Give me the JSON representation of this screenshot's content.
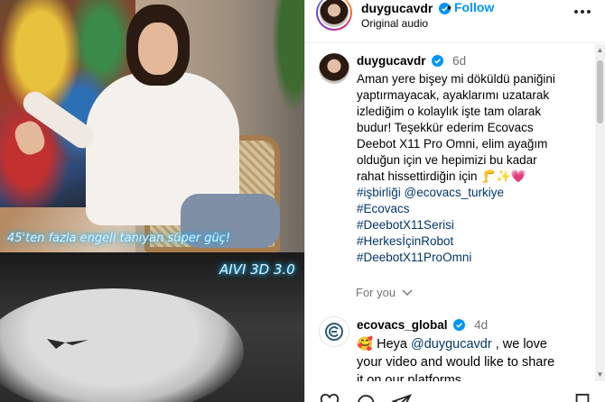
{
  "media": {
    "caption_top": "45'ten fazla engeli tanıyan süper güç!",
    "caption_bottom": "AIVI 3D 3.0"
  },
  "header": {
    "username": "duygucavdr",
    "separator": "•",
    "follow_label": "Follow",
    "audio": "Original audio"
  },
  "caption_comment": {
    "username": "duygucavdr",
    "time": "6d",
    "text": "Aman yere bişey mi döküldü paniğini yaptırmayacak, ayaklarımı uzatarak izlediğim o kolaylık işte tam olarak budur! Teşekkür ederim Ecovacs Deebot X11 Pro Omni, elim ayağım olduğun için ve hepimizi bu kadar rahat hissettirdiğin için 🦵✨💗",
    "hashtag_1": "#işbirliği",
    "mention_1": "@ecovacs_turkiye",
    "hashtag_2": "#Ecovacs",
    "hashtag_3": "#DeebotX11Serisi",
    "hashtag_4": "#HerkesİçinRobot",
    "hashtag_5": "#DeebotX11ProOmni",
    "for_you": "For you"
  },
  "reply_comment": {
    "username": "ecovacs_global",
    "time": "4d",
    "emoji": "🥰",
    "text_before": "Heya ",
    "mention": "@duygucavdr",
    "text_after": " , we love your video and would like to share it on our platforms"
  },
  "colors": {
    "accent_link": "#0095f6",
    "hashtag": "#00376b",
    "muted": "#737373",
    "verified": "#0095f6"
  },
  "icons": [
    "verified-icon",
    "more-options-icon",
    "chevron-down-icon",
    "heart-icon",
    "comment-icon",
    "share-icon",
    "bookmark-icon"
  ]
}
